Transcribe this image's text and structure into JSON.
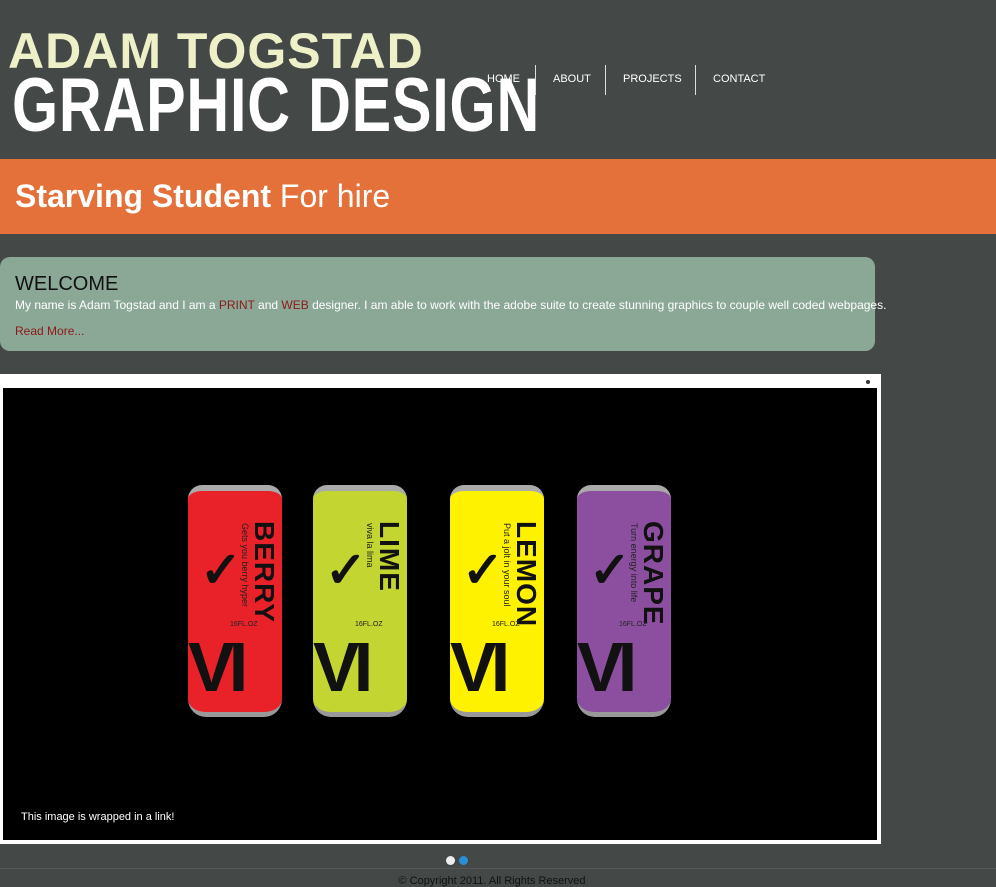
{
  "logo": {
    "line1": "ADAM TOGSTAD",
    "line2": "GRAPHIC DESIGN"
  },
  "nav": [
    "HOME",
    "ABOUT",
    "PROJECTS",
    "CONTACT"
  ],
  "tagline": {
    "bold": "Starving Student",
    "rest": " For hire"
  },
  "welcome": {
    "title": "WELCOME",
    "t1": "My name is Adam Togstad and I am a ",
    "print": "PRINT",
    "t2": " and ",
    "web": "WEB",
    "t3": " designer. I am able to work with the adobe suite to create stunning graphics to couple well coded webpages.",
    "more": "Read More..."
  },
  "slider": {
    "caption": "This image is wrapped in a link!",
    "cans": [
      {
        "name": "BERRY",
        "sub": "Gets you berry hyper",
        "oz": "16FL.OZ",
        "color": "#e82228"
      },
      {
        "name": "LIME",
        "sub": "viva la lima",
        "oz": "16FL.OZ",
        "color": "#c2d530"
      },
      {
        "name": "LEMON",
        "sub": "Put a jolt in your soul",
        "oz": "16FL.OZ",
        "color": "#fff200"
      },
      {
        "name": "GRAPE",
        "sub": "Turn energy into life",
        "oz": "16FL.OZ",
        "color": "#8c4fa0"
      }
    ],
    "active_slide": 2,
    "slide_count": 2
  },
  "footer": {
    "copyright": "© Copyright 2011. All Rights Reserved"
  }
}
